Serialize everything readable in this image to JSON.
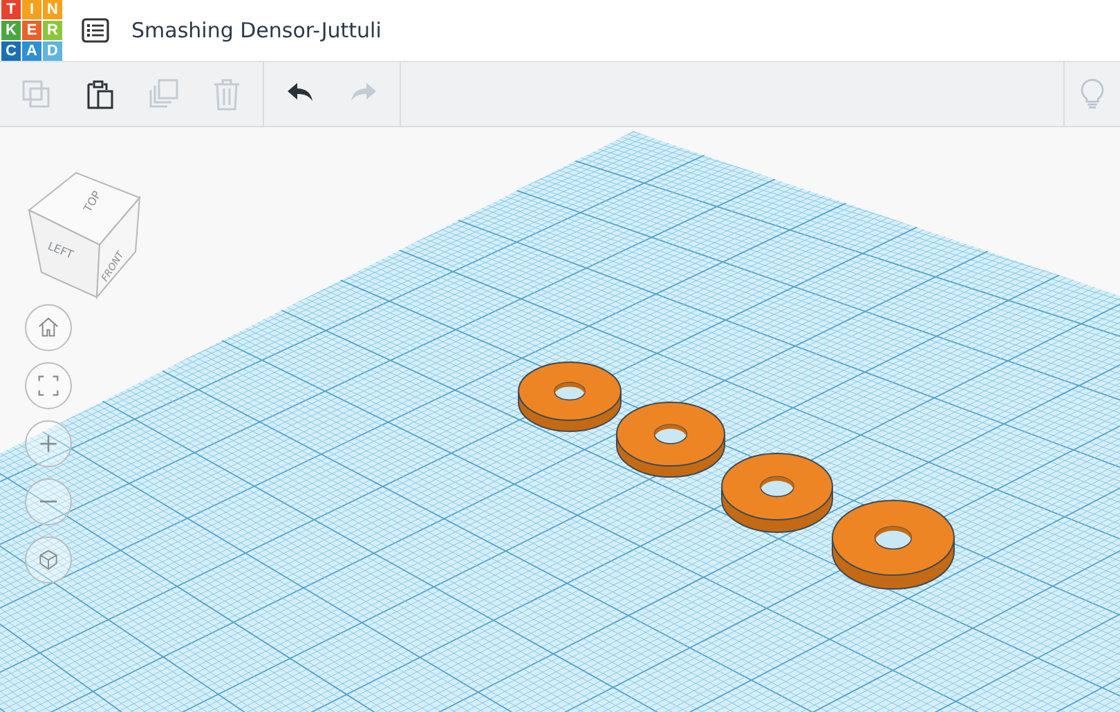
{
  "logo": {
    "letters": [
      {
        "text": "T",
        "color": "#e8412c"
      },
      {
        "text": "I",
        "color": "#f5a11c"
      },
      {
        "text": "N",
        "color": "#f5a11c"
      },
      {
        "text": "K",
        "color": "#4ca63f"
      },
      {
        "text": "E",
        "color": "#e8622c"
      },
      {
        "text": "R",
        "color": "#8cc63f"
      },
      {
        "text": "C",
        "color": "#1b6fb5"
      },
      {
        "text": "A",
        "color": "#2d8fd4"
      },
      {
        "text": "D",
        "color": "#5fb4e0"
      }
    ]
  },
  "title": "Smashing Densor-Juttuli",
  "toolbar": {
    "buttons": [
      {
        "disabled": true
      },
      {
        "disabled": false
      },
      {
        "disabled": true
      },
      {
        "disabled": true
      },
      {
        "disabled": false
      },
      {
        "disabled": true
      }
    ],
    "hint_button": {
      "disabled": true
    }
  },
  "view_cube": {
    "top": "TOP",
    "left": "LEFT",
    "front": "FRONT"
  }
}
